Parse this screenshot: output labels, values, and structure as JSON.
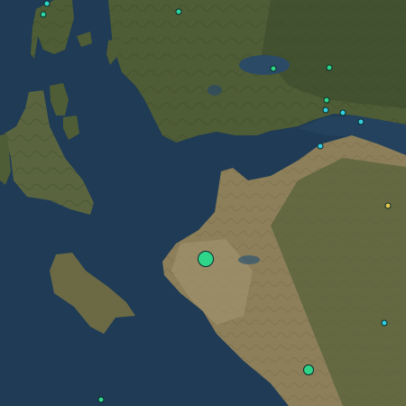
{
  "map": {
    "colors": {
      "sea": "#1f3b55",
      "sea_shallow": "#2c4e66",
      "land_green": "#4f5d36",
      "land_dark": "#3b4a2b",
      "land_tan": "#8d7f5a",
      "land_light": "#a89775"
    },
    "markers": [
      {
        "id": "m1",
        "color": "#2fd6c8",
        "magnitude": "small"
      },
      {
        "id": "m2",
        "color": "#2fd6a0",
        "magnitude": "small"
      },
      {
        "id": "m3",
        "color": "#2fd6a0",
        "magnitude": "small"
      },
      {
        "id": "m4",
        "color": "#2fd68a",
        "magnitude": "small"
      },
      {
        "id": "m5",
        "color": "#2fd68a",
        "magnitude": "small"
      },
      {
        "id": "m6",
        "color": "#2fd68a",
        "magnitude": "small"
      },
      {
        "id": "m7",
        "color": "#33cfe0",
        "magnitude": "small"
      },
      {
        "id": "m8",
        "color": "#33cfe0",
        "magnitude": "small"
      },
      {
        "id": "m9",
        "color": "#33cfe0",
        "magnitude": "small"
      },
      {
        "id": "m10",
        "color": "#33cfe0",
        "magnitude": "small"
      },
      {
        "id": "m11",
        "color": "#e3c84a",
        "magnitude": "small"
      },
      {
        "id": "m12",
        "color": "#2fd68a",
        "magnitude": "large"
      },
      {
        "id": "m13",
        "color": "#33cfe0",
        "magnitude": "small"
      },
      {
        "id": "m14",
        "color": "#2fd68a",
        "magnitude": "medium"
      },
      {
        "id": "m15",
        "color": "#2fd68a",
        "magnitude": "small"
      }
    ]
  }
}
